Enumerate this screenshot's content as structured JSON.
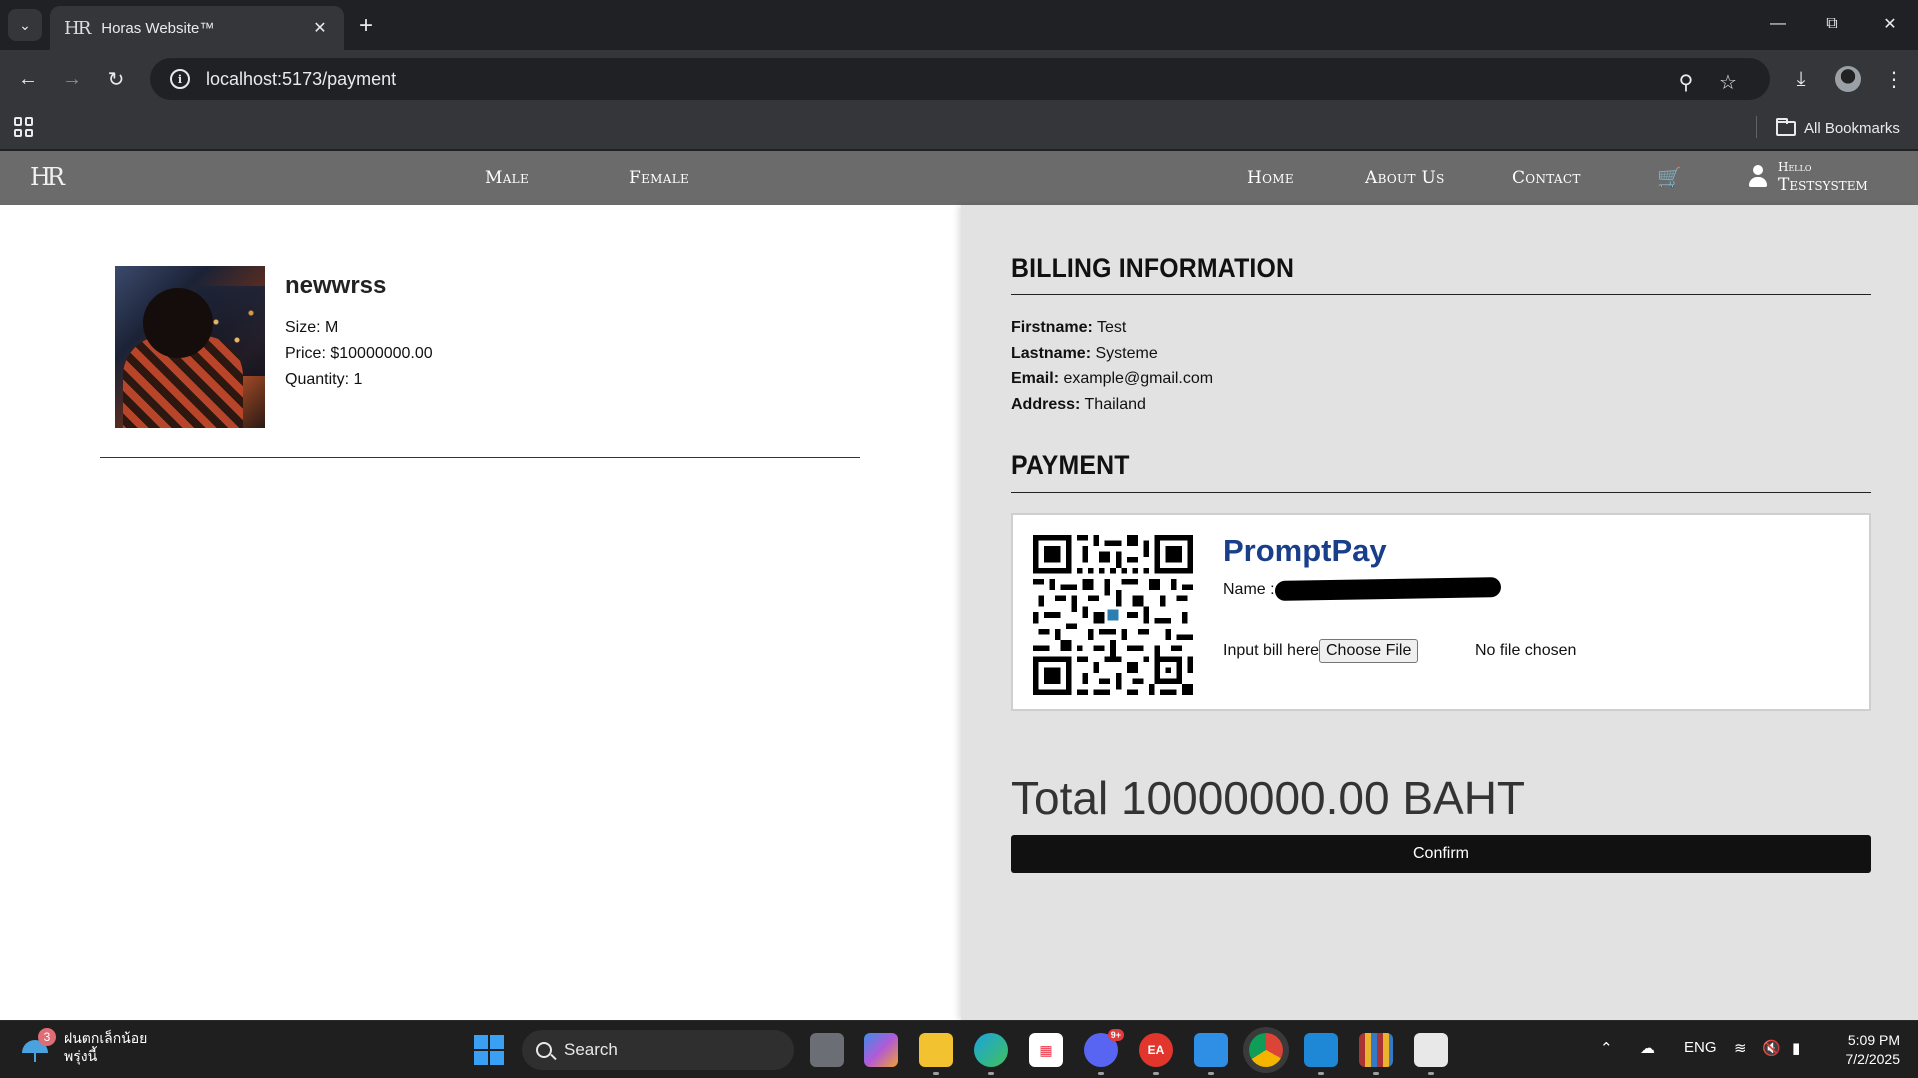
{
  "browser": {
    "tab_title": "Horas Website™",
    "tab_favicon": "HR",
    "url": "localhost:5173/payment",
    "all_bookmarks": "All Bookmarks"
  },
  "site": {
    "logo": "HR",
    "nav_left": [
      "Male",
      "Female"
    ],
    "nav_right": [
      "Home",
      "About Us",
      "Contact"
    ],
    "greeting": "Hello",
    "username": "Testsystem"
  },
  "cart_item": {
    "name": "newwrss",
    "size": "Size: M",
    "price": "Price: $10000000.00",
    "quantity": "Quantity: 1"
  },
  "billing": {
    "title": "BILLING INFORMATION",
    "rows": [
      {
        "label": "Firstname:",
        "value": "Test"
      },
      {
        "label": "Lastname:",
        "value": "Systeme"
      },
      {
        "label": "Email:",
        "value": "example@gmail.com"
      },
      {
        "label": "Address:",
        "value": "Thailand"
      }
    ]
  },
  "payment": {
    "title": "PAYMENT",
    "provider": "PromptPay",
    "name_label": "Name :",
    "upload_label": "Input bill here",
    "file_button": "Choose File",
    "file_status": "No file chosen"
  },
  "total": "Total 10000000.00 BAHT",
  "confirm_label": "Confirm",
  "taskbar": {
    "weather_line1": "ฝนตกเล็กน้อย",
    "weather_line2": "พรุ่งนี้",
    "weather_badge": "3",
    "search_label": "Search",
    "language": "ENG",
    "time": "5:09 PM",
    "date": "7/2/2025",
    "discord_badge": "9+"
  },
  "colors": {
    "site_nav": "#6b6b6b",
    "right_panel": "#e2e2e2",
    "promptpay_blue": "#1a3f8a",
    "confirm_button": "#111111"
  }
}
